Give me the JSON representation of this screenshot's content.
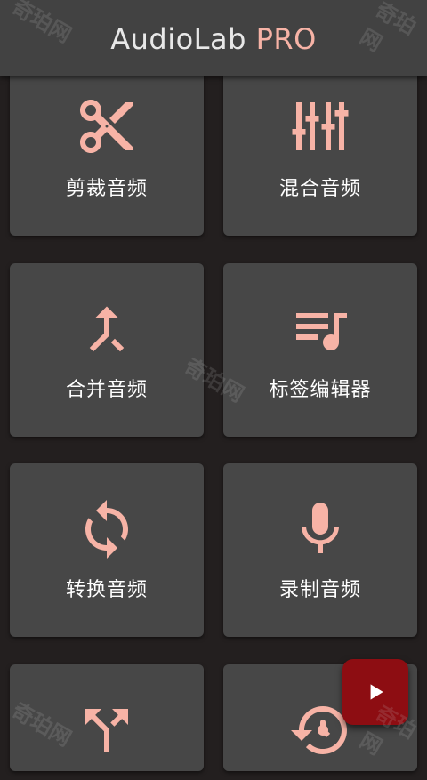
{
  "app_bar": {
    "title_part1": "AudioLab",
    "title_accent": " PRO"
  },
  "colors": {
    "accent": "#f7b3a6",
    "card_bg": "#474747",
    "app_bar_bg": "#424242",
    "background": "#231f1f",
    "fab_bg": "#8d0d12"
  },
  "tiles": [
    {
      "label": "剪裁音频",
      "icon": "scissors-icon"
    },
    {
      "label": "混合音频",
      "icon": "mixer-sliders-icon"
    },
    {
      "label": "合并音频",
      "icon": "merge-arrows-icon"
    },
    {
      "label": "标签编辑器",
      "icon": "playlist-music-icon"
    },
    {
      "label": "转换音频",
      "icon": "sync-arrows-icon"
    },
    {
      "label": "录制音频",
      "icon": "microphone-icon"
    },
    {
      "label": "",
      "icon": "split-arrows-icon"
    },
    {
      "label": "",
      "icon": "restore-icon"
    }
  ],
  "fab": {
    "icon": "play-icon"
  },
  "watermark": "奇珀网"
}
